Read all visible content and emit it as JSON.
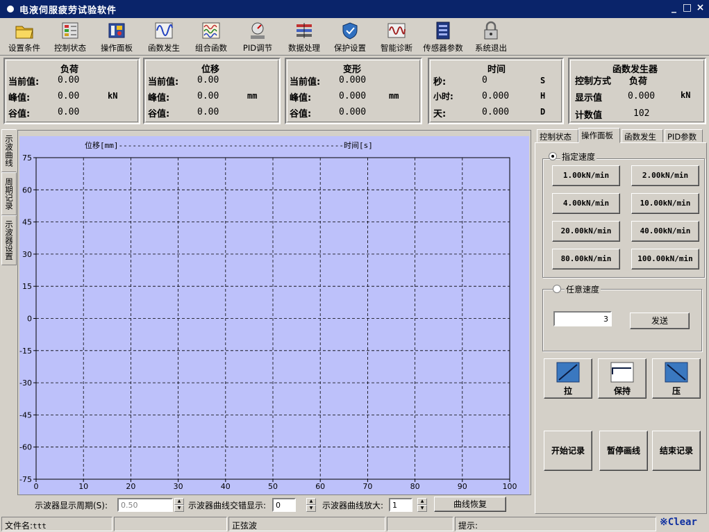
{
  "window": {
    "title": "电液伺服疲劳试验软件",
    "controls": [
      "_",
      "□",
      "×"
    ]
  },
  "toolbar": [
    {
      "label": "设置条件",
      "icon": "folder-icon"
    },
    {
      "label": "控制状态",
      "icon": "control-status-icon"
    },
    {
      "label": "操作面板",
      "icon": "operation-panel-icon"
    },
    {
      "label": "函数发生",
      "icon": "waveform-icon"
    },
    {
      "label": "组合函数",
      "icon": "combined-function-icon"
    },
    {
      "label": "PID调节",
      "icon": "pid-icon"
    },
    {
      "label": "数据处理",
      "icon": "data-processing-icon"
    },
    {
      "label": "保护设置",
      "icon": "protection-icon"
    },
    {
      "label": "智能诊断",
      "icon": "diagnosis-icon"
    },
    {
      "label": "传感器参数",
      "icon": "sensor-icon"
    },
    {
      "label": "系统退出",
      "icon": "lock-icon"
    }
  ],
  "panels": {
    "load": {
      "title": "负荷",
      "current_label": "当前值:",
      "current": "0.00",
      "peak_label": "峰值:",
      "peak": "0.00",
      "unit": "kN",
      "valley_label": "谷值:",
      "valley": "0.00"
    },
    "displacement": {
      "title": "位移",
      "current_label": "当前值:",
      "current": "0.00",
      "peak_label": "峰值:",
      "peak": "0.00",
      "unit": "mm",
      "valley_label": "谷值:",
      "valley": "0.00"
    },
    "deformation": {
      "title": "变形",
      "current_label": "当前值:",
      "current": "0.000",
      "peak_label": "峰值:",
      "peak": "0.000",
      "unit": "mm",
      "valley_label": "谷值:",
      "valley": "0.000"
    },
    "time": {
      "title": "时间",
      "sec_label": "秒:",
      "sec": "0",
      "sec_unit": "S",
      "hour_label": "小时:",
      "hour": "0.000",
      "hour_unit": "H",
      "day_label": "天:",
      "day": "0.000",
      "day_unit": "D"
    },
    "function_gen": {
      "title": "函数发生器",
      "mode_label": "控制方式",
      "mode": "负荷",
      "display_label": "显示值",
      "display": "0.000",
      "unit": "kN",
      "count_label": "计数值",
      "count": "102"
    }
  },
  "left_tabs": [
    "示波曲线",
    "周期记录",
    "示波器设置"
  ],
  "chart_header": "位移[mm]-------------------------------------------------时间[s]",
  "chart_data": {
    "type": "line",
    "xlabel": "时间[s]",
    "ylabel": "位移[mm]",
    "xlim": [
      0,
      100
    ],
    "ylim": [
      -75,
      75
    ],
    "x_ticks": [
      0,
      10,
      20,
      30,
      40,
      50,
      60,
      70,
      80,
      90,
      100
    ],
    "y_ticks": [
      75,
      60,
      45,
      30,
      15,
      0,
      -15,
      -30,
      -45,
      -60,
      -75
    ],
    "grid": true,
    "series": []
  },
  "bottom": {
    "period_label": "示波器显示周期(S):",
    "period_value": "0.50",
    "stagger_label": "示波器曲线交错显示:",
    "stagger_value": "0",
    "zoom_label": "示波器曲线放大:",
    "zoom_value": "1",
    "restore_label": "曲线恢复"
  },
  "right_tabs": [
    "控制状态",
    "操作面板",
    "函数发生",
    "PID参数"
  ],
  "right_panel": {
    "preset_label": "指定速度",
    "speeds": [
      "1.00kN/min",
      "2.00kN/min",
      "4.00kN/min",
      "10.00kN/min",
      "20.00kN/min",
      "40.00kN/min",
      "80.00kN/min",
      "100.00kN/min"
    ],
    "custom_label": "任意速度",
    "custom_value": "3",
    "send_label": "发送",
    "action_tension": "拉",
    "action_hold": "保持",
    "action_compress": "压",
    "start_record": "开始记录",
    "pause_curve": "暂停画线",
    "stop_record": "结束记录"
  },
  "statusbar": {
    "file_label": "文件名:",
    "file_name": "ttt",
    "wave": "正弦波",
    "hint_label": "提示:",
    "clear": "※Clear"
  }
}
